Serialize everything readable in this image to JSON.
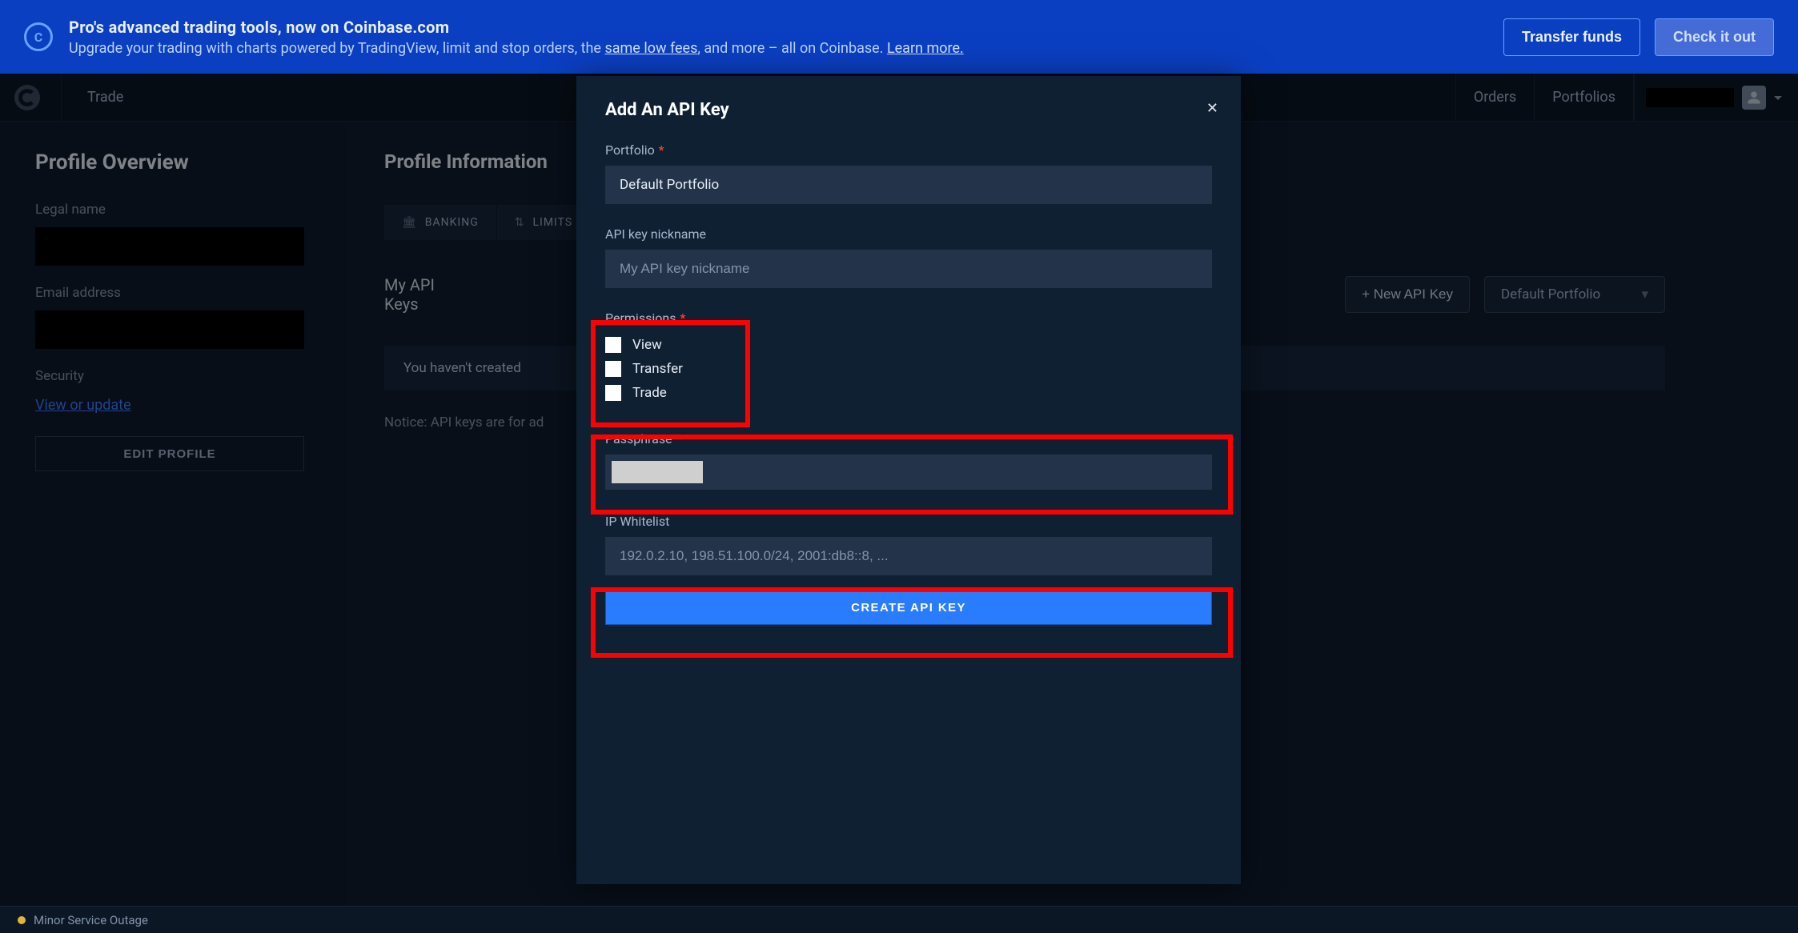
{
  "promo": {
    "title": "Pro's advanced trading tools, now on Coinbase.com",
    "subtitle_prefix": "Upgrade your trading with charts powered by TradingView, limit and stop orders, the ",
    "subtitle_link1": "same low fees",
    "subtitle_mid": ", and more – all on Coinbase. ",
    "subtitle_link2": "Learn more.",
    "transfer_btn": "Transfer funds",
    "check_btn": "Check it out"
  },
  "topnav": {
    "trade": "Trade",
    "orders": "Orders",
    "portfolios": "Portfolios"
  },
  "sidebar": {
    "heading": "Profile Overview",
    "legal_label": "Legal name",
    "email_label": "Email address",
    "security_label": "Security",
    "view_update": "View or update",
    "edit_btn": "EDIT PROFILE"
  },
  "content": {
    "heading": "Profile Information",
    "tabs": {
      "banking": "BANKING",
      "limits": "LIMITS"
    },
    "section": "My API Keys",
    "new_api_btn": "+ New API Key",
    "portfolio_selected": "Default Portfolio",
    "info_strip": "You haven't created",
    "notice": "Notice: API keys are for ad"
  },
  "modal": {
    "title": "Add An API Key",
    "labels": {
      "portfolio": "Portfolio",
      "nickname": "API key nickname",
      "permissions": "Permissions",
      "passphrase": "Passphrase",
      "ip_whitelist": "IP Whitelist"
    },
    "portfolio_value": "Default Portfolio",
    "nickname_placeholder": "My API key nickname",
    "permissions": {
      "view": "View",
      "transfer": "Transfer",
      "trade": "Trade"
    },
    "ip_placeholder": "192.0.2.10, 198.51.100.0/24, 2001:db8::8, ...",
    "create_btn": "CREATE API KEY"
  },
  "footer": {
    "status": "Minor Service Outage"
  }
}
